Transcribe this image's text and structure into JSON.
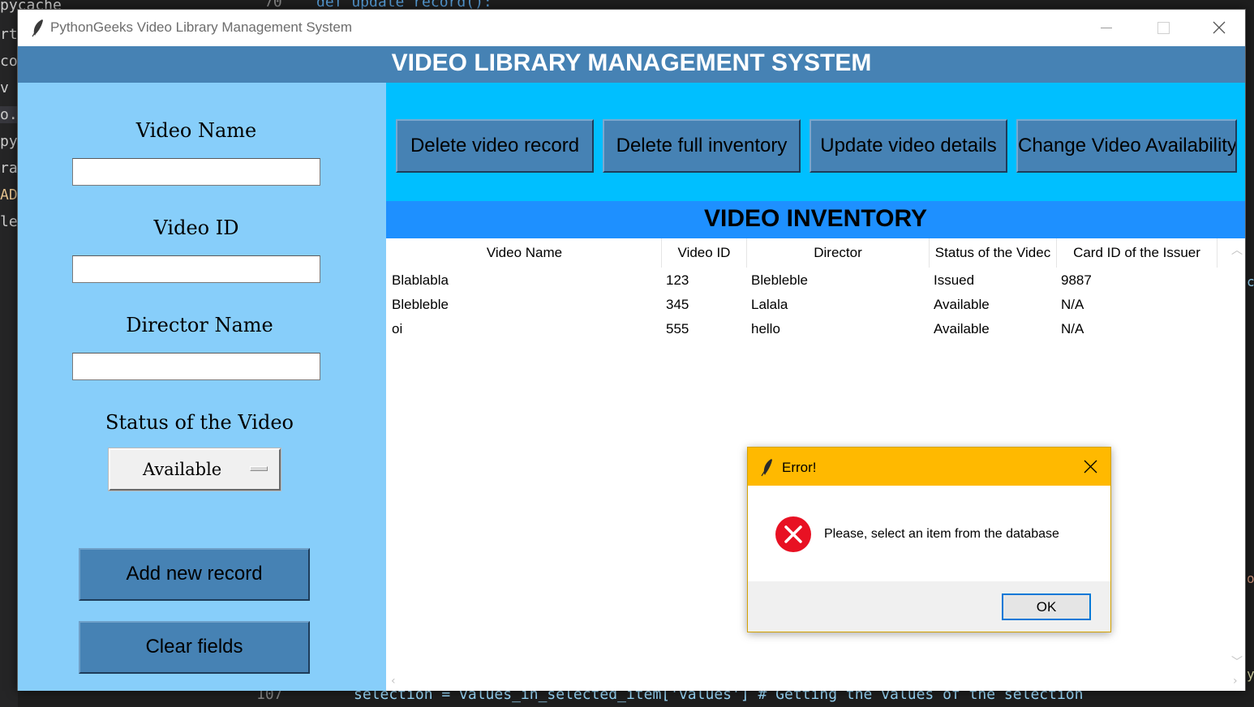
{
  "window": {
    "title": "PythonGeeks Video Library Management System",
    "header_title": "VIDEO LIBRARY MANAGEMENT SYSTEM"
  },
  "form": {
    "video_name_label": "Video Name",
    "video_name_value": "",
    "video_id_label": "Video ID",
    "video_id_value": "",
    "director_label": "Director Name",
    "director_value": "",
    "status_label": "Status of the Video",
    "status_selected": "Available",
    "add_button": "Add new record",
    "clear_button": "Clear fields"
  },
  "toolbar": {
    "delete_record": "Delete video record",
    "delete_inventory": "Delete full inventory",
    "update_details": "Update video details",
    "change_availability": "Change Video Availability"
  },
  "inventory": {
    "title": "VIDEO INVENTORY",
    "columns": [
      "Video Name",
      "Video ID",
      "Director",
      "Status of the Videc",
      "Card ID of the Issuer"
    ],
    "rows": [
      [
        "Blablabla",
        "123",
        "Blebleble",
        "Issued",
        "9887"
      ],
      [
        "Blebleble",
        "345",
        "Lalala",
        "Available",
        "N/A"
      ],
      [
        "oi",
        "555",
        "hello",
        "Available",
        "N/A"
      ]
    ]
  },
  "dialog": {
    "title": "Error!",
    "message": "Please, select an item from the database",
    "ok_button": "OK"
  },
  "background_editor": {
    "files": [
      "pycache",
      "rtes",
      "coc",
      "v",
      "o.py",
      "py.p",
      "rar",
      "AD",
      "lec"
    ],
    "line_numbers": [
      "70",
      "107"
    ],
    "code_top": "def update_record():",
    "code_bottom": "selection = values_in_selected_item['values'] # Getting the values of the selection"
  },
  "colors": {
    "header": "#4682b4",
    "left_panel": "#87cefa",
    "button_band": "#00bfff",
    "inventory_band": "#1e90ff",
    "button": "#4682b4",
    "dialog_titlebar": "#ffb900",
    "error_icon": "#e81123"
  }
}
